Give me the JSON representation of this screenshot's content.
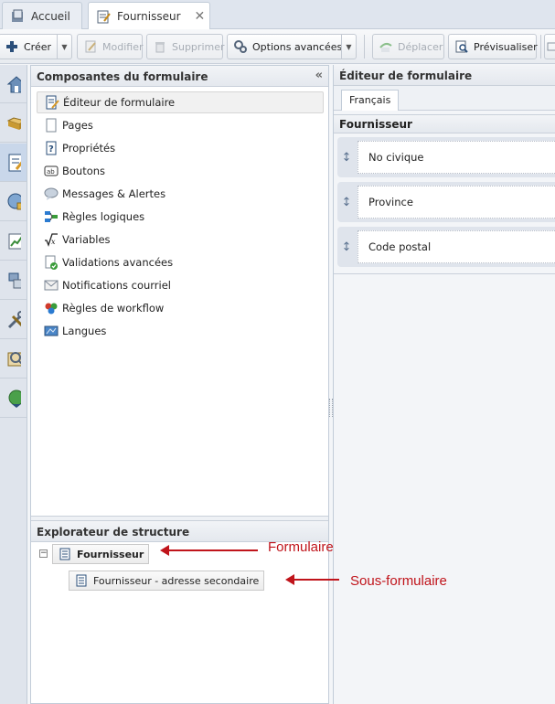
{
  "tabs": [
    {
      "label": "Accueil",
      "icon": "home-tab-icon"
    },
    {
      "label": "Fournisseur",
      "icon": "form-tab-icon",
      "close": "✕"
    }
  ],
  "toolbar": {
    "create": "Créer",
    "edit": "Modifier",
    "delete": "Supprimer",
    "advanced": "Options avancées",
    "move": "Déplacer",
    "preview": "Prévisualiser"
  },
  "left_panel": {
    "title": "Composantes du formulaire",
    "collapse": "«",
    "items": [
      {
        "label": "Éditeur de formulaire",
        "icon": "form-editor-icon"
      },
      {
        "label": "Pages",
        "icon": "pages-icon"
      },
      {
        "label": "Propriétés",
        "icon": "properties-icon"
      },
      {
        "label": "Boutons",
        "icon": "buttons-icon"
      },
      {
        "label": "Messages & Alertes",
        "icon": "messages-icon"
      },
      {
        "label": "Règles logiques",
        "icon": "logic-rules-icon"
      },
      {
        "label": "Variables",
        "icon": "variables-icon"
      },
      {
        "label": "Validations avancées",
        "icon": "validations-icon"
      },
      {
        "label": "Notifications courriel",
        "icon": "email-icon"
      },
      {
        "label": "Règles de workflow",
        "icon": "workflow-icon"
      },
      {
        "label": "Langues",
        "icon": "languages-icon"
      }
    ]
  },
  "explorer": {
    "title": "Explorateur de structure",
    "root": "Fournisseur",
    "child": "Fournisseur - adresse secondaire"
  },
  "right_panel": {
    "title": "Éditeur de formulaire",
    "language_tab": "Français",
    "form_title": "Fournisseur",
    "fields": [
      "No civique",
      "Province",
      "Code postal"
    ]
  },
  "annotations": {
    "form": "Formulaire",
    "subform": "Sous-formulaire"
  },
  "colors": {
    "annotation": "#c0141b",
    "accent": "#5b7290"
  }
}
